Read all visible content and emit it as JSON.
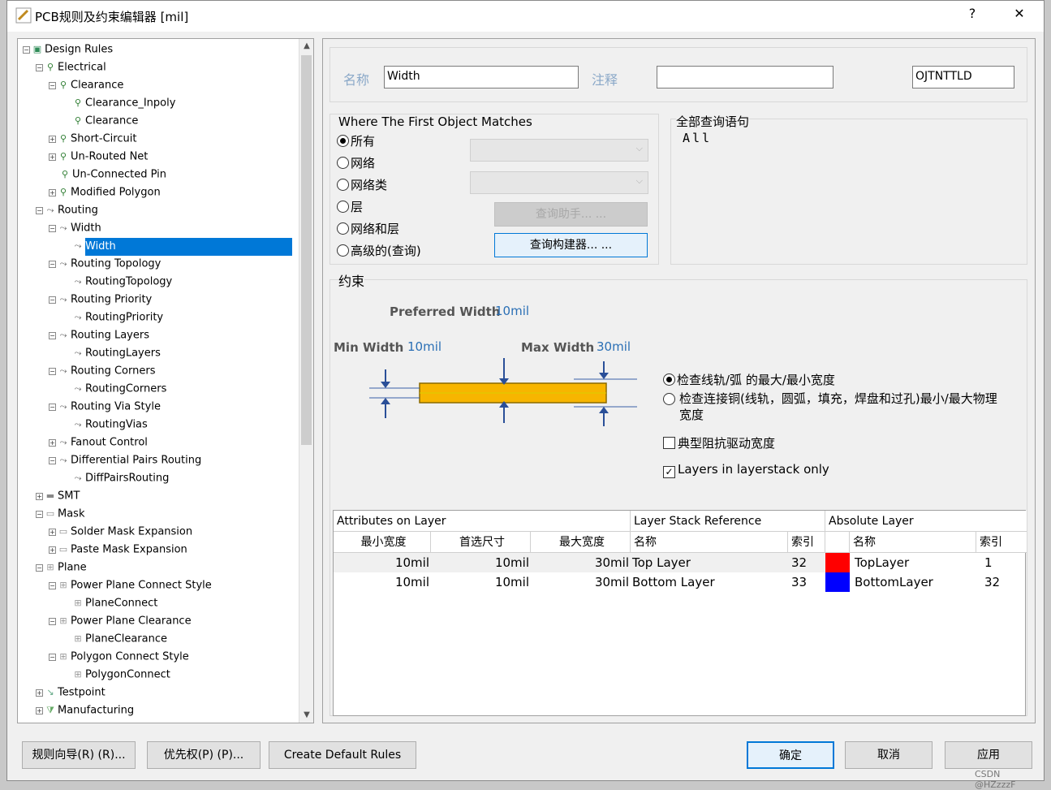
{
  "window": {
    "title": "PCB规则及约束编辑器 [mil]",
    "help": "?",
    "close": "✕"
  },
  "tree": {
    "items": [
      {
        "label": "Design Rules"
      },
      {
        "label": "Electrical"
      },
      {
        "label": "Clearance"
      },
      {
        "label": "Clearance_Inpoly"
      },
      {
        "label": "Clearance"
      },
      {
        "label": "Short-Circuit"
      },
      {
        "label": "Un-Routed Net"
      },
      {
        "label": "Un-Connected Pin"
      },
      {
        "label": "Modified Polygon"
      },
      {
        "label": "Routing"
      },
      {
        "label": "Width"
      },
      {
        "label": "Width"
      },
      {
        "label": "Routing Topology"
      },
      {
        "label": "RoutingTopology"
      },
      {
        "label": "Routing Priority"
      },
      {
        "label": "RoutingPriority"
      },
      {
        "label": "Routing Layers"
      },
      {
        "label": "RoutingLayers"
      },
      {
        "label": "Routing Corners"
      },
      {
        "label": "RoutingCorners"
      },
      {
        "label": "Routing Via Style"
      },
      {
        "label": "RoutingVias"
      },
      {
        "label": "Fanout Control"
      },
      {
        "label": "Differential Pairs Routing"
      },
      {
        "label": "DiffPairsRouting"
      },
      {
        "label": "SMT"
      },
      {
        "label": "Mask"
      },
      {
        "label": "Solder Mask Expansion"
      },
      {
        "label": "Paste Mask Expansion"
      },
      {
        "label": "Plane"
      },
      {
        "label": "Power Plane Connect Style"
      },
      {
        "label": "PlaneConnect"
      },
      {
        "label": "Power Plane Clearance"
      },
      {
        "label": "PlaneClearance"
      },
      {
        "label": "Polygon Connect Style"
      },
      {
        "label": "PolygonConnect"
      },
      {
        "label": "Testpoint"
      },
      {
        "label": "Manufacturing"
      }
    ]
  },
  "rule": {
    "name_label": "名称",
    "name_value": "Width",
    "comment_label": "注释",
    "comment_value": "",
    "id_value": "OJTNTTLD"
  },
  "where": {
    "title": "Where The First Object Matches",
    "options": [
      "所有",
      "网络",
      "网络类",
      "层",
      "网络和层",
      "高级的(查询)"
    ],
    "query_helper": "查询助手... ...",
    "query_builder": "查询构建器... ..."
  },
  "full_query": {
    "title": "全部查询语句",
    "text": "All"
  },
  "constraints": {
    "title": "约束",
    "preferred_label": "Preferred Width",
    "preferred_value": "10mil",
    "min_label": "Min Width",
    "min_value": "10mil",
    "max_label": "Max Width",
    "max_value": "30mil",
    "check_opt1": "检查线轨/弧 的最大/最小宽度",
    "check_opt2": "检查连接铜(线轨，圆弧，填充，焊盘和过孔)最小/最大物理宽度",
    "impedance": "典型阻抗驱动宽度",
    "layerstack_only": "Layers in layerstack only"
  },
  "table": {
    "group_headers": [
      "Attributes on Layer",
      "Layer Stack Reference",
      "Absolute Layer"
    ],
    "columns": [
      "最小宽度",
      "首选尺寸",
      "最大宽度",
      "名称",
      "索引",
      "名称",
      "索引"
    ],
    "rows": [
      {
        "min": "10mil",
        "pref": "10mil",
        "max": "30mil",
        "name": "Top Layer",
        "idx": "32",
        "abs_name": "TopLayer",
        "abs_idx": "1",
        "color": "#ff0000"
      },
      {
        "min": "10mil",
        "pref": "10mil",
        "max": "30mil",
        "name": "Bottom Layer",
        "idx": "33",
        "abs_name": "BottomLayer",
        "abs_idx": "32",
        "color": "#0000ff"
      }
    ]
  },
  "buttons": {
    "rule_wizard": "规则向导(R) (R)...",
    "priority": "优先权(P) (P)...",
    "create_default": "Create Default Rules",
    "ok": "确定",
    "cancel": "取消",
    "apply": "应用"
  },
  "watermark": "CSDN @HZzzzF"
}
